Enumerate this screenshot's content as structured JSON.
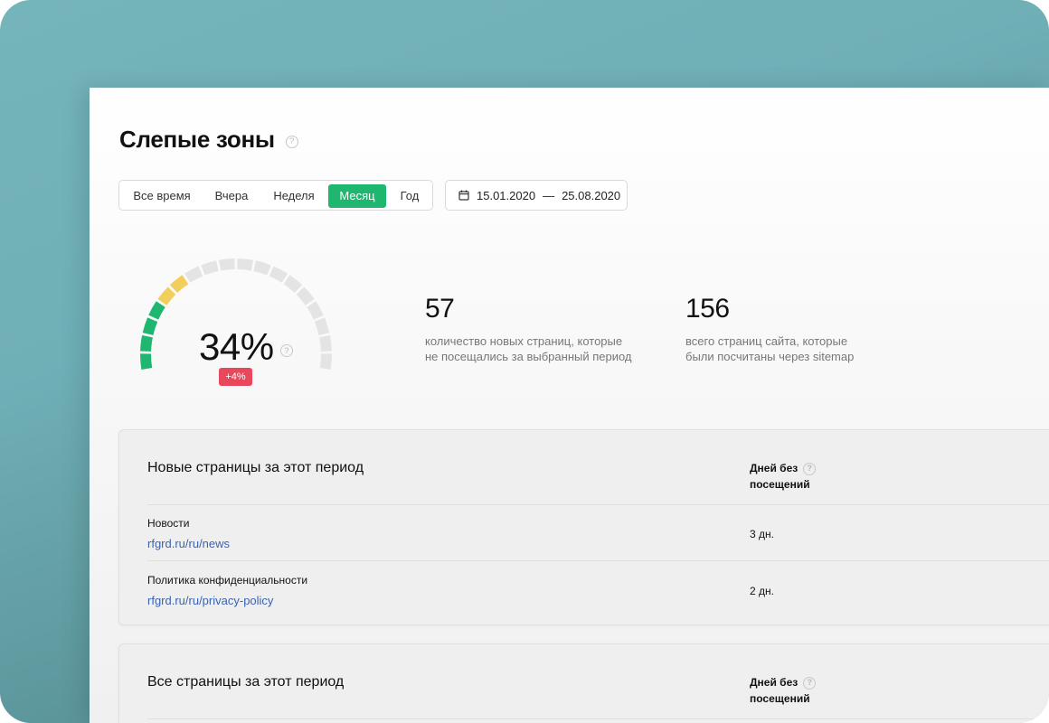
{
  "header": {
    "title": "Слепые зоны",
    "help_glyph": "?"
  },
  "period": {
    "tabs": [
      {
        "label": "Все время",
        "active": false
      },
      {
        "label": "Вчера",
        "active": false
      },
      {
        "label": "Неделя",
        "active": false
      },
      {
        "label": "Месяц",
        "active": true
      },
      {
        "label": "Год",
        "active": false
      }
    ],
    "date_from": "15.01.2020",
    "date_separator": "—",
    "date_to": "25.08.2020",
    "icon": "calendar-icon"
  },
  "gauge": {
    "value_text": "34%",
    "value_fraction": 0.34,
    "delta": "+4%",
    "colors": {
      "good": "#1fb670",
      "warn": "#f2cf5b",
      "empty": "#e4e4e4",
      "delta_bg": "#e9475b"
    }
  },
  "stats": [
    {
      "value": "57",
      "desc_line1": "количество новых страниц, которые",
      "desc_line2": "не посещались за выбранный период"
    },
    {
      "value": "156",
      "desc_line1": "всего страниц сайта, которые",
      "desc_line2": "были посчитаны через sitemap"
    }
  ],
  "new_pages": {
    "title": "Новые страницы за этот период",
    "col_header_line1": "Дней без",
    "col_header_line2": "посещений",
    "rows": [
      {
        "name": "Новости",
        "url": "rfgrd.ru/ru/news",
        "days": "3 дн."
      },
      {
        "name": "Политика конфиденциальности",
        "url": "rfgrd.ru/ru/privacy-policy",
        "days": "2 дн."
      }
    ]
  },
  "all_pages": {
    "title": "Все страницы за этот период",
    "col_header_line1": "Дней без",
    "col_header_line2": "посещений"
  },
  "colors": {
    "accent": "#1fb670",
    "link": "#3b63b3"
  }
}
